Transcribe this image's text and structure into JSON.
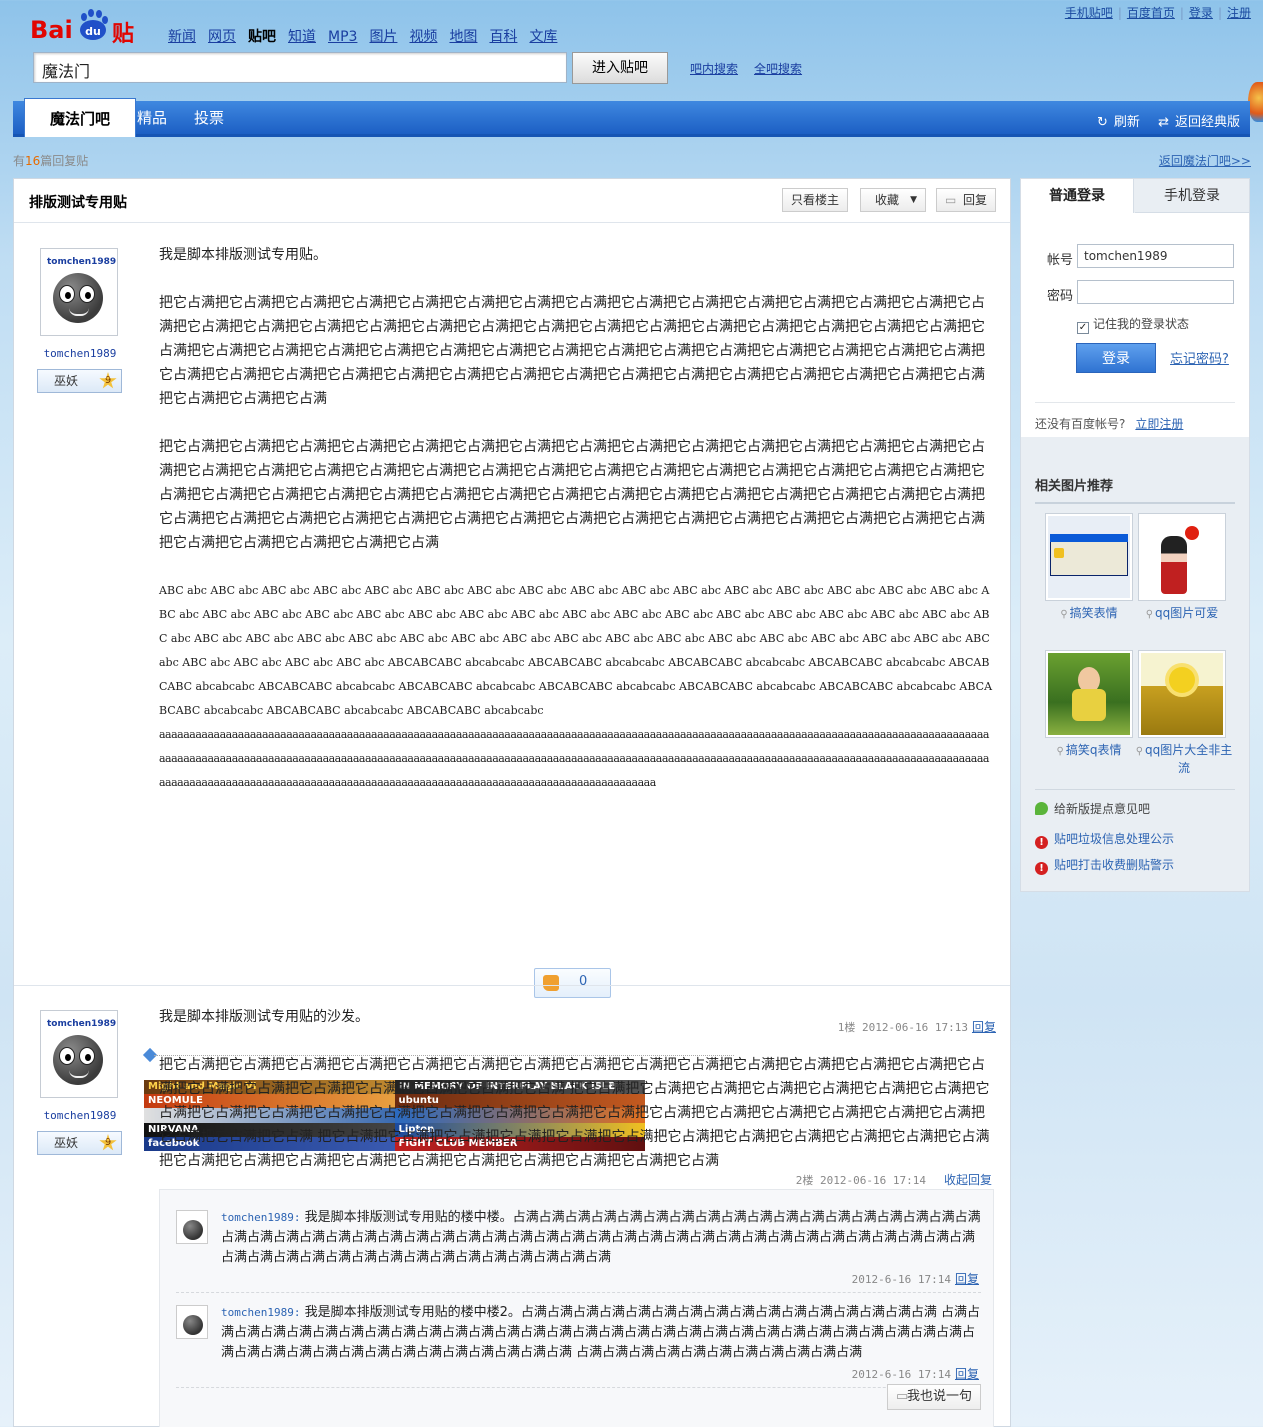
{
  "toplinks": [
    "手机贴吧",
    "百度首页",
    "登录",
    "注册"
  ],
  "logo": {
    "left": "Bai",
    "paw": "du",
    "right": "贴吧"
  },
  "nav": {
    "items": [
      "新闻",
      "网页",
      "贴吧",
      "知道",
      "MP3",
      "图片",
      "视频",
      "地图",
      "百科",
      "文库"
    ],
    "current": "贴吧"
  },
  "search": {
    "value": "魔法门",
    "enter_label": "进入贴吧",
    "in_bar": "吧内搜索",
    "all_bar": "全吧搜索"
  },
  "tabs": {
    "active": "魔法门吧",
    "jingpin": "精品",
    "vote": "投票",
    "refresh": "刷新",
    "classic": "返回经典版"
  },
  "reply_count": {
    "prefix": "有",
    "count": "16",
    "suffix": "篇回复贴"
  },
  "back_link": "返回魔法门吧>>",
  "thread": {
    "title": "排版测试专用贴",
    "btn_only_owner": "只看楼主",
    "btn_fav": "收藏",
    "btn_reply": "回复"
  },
  "post1": {
    "username": "tomchen1989",
    "avatar_name": "tomchen1989",
    "rank": "巫妖",
    "level": "9",
    "line1": "我是脚本排版测试专用贴。",
    "para2": "把它占满把它占满把它占满把它占满把它占满把它占满把它占满把它占满把它占满把它占满把它占满把它占满把它占满把它占满把它占满把它占满把它占满把它占满把它占满把它占满把它占满把它占满把它占满把它占满把它占满把它占满把它占满把它占满把它占满把它占满把它占满把它占满把它占满把它占满把它占满把它占满把它占满把它占满把它占满把它占满把它占满把它占满把它占满把它占满把它占满把它占满把它占满把它占满把它占满把它占满把它占满把它占满把它占满把它占满把它占满把它占满把它占满把它占满把它占满把它占满把它占满把它占满",
    "para3": "把它占满把它占满把它占满把它占满把它占满把它占满把它占满把它占满把它占满把它占满把它占满把它占满把它占满把它占满把它占满把它占满把它占满把它占满把它占满把它占满把它占满把它占满把它占满把它占满把它占满把它占满把它占满把它占满把它占满把它占满把它占满把它占满把它占满把它占满把它占满把它占满把它占满把它占满把它占满把它占满把它占满把它占满把它占满把它占满把它占满把它占满把它占满把它占满把它占满把它占满把它占满把它占满把它占满把它占满把它占满把它占满把它占满把它占满把它占满把它占满把它占满把它占满把它占满把它占满",
    "mono1": "ABC abc ABC abc ABC abc ABC abc ABC abc ABC abc ABC abc ABC abc ABC abc ABC abc ABC abc ABC abc ABC abc ABC abc ABC abc ABC abc ABC abc ABC abc ABC abc ABC abc ABC abc ABC abc ABC abc ABC abc ABC abc ABC abc ABC abc ABC abc ABC abc ABC abc ABC abc ABC abc ABC abc ABC abc ABC abc ABC abc ABC abc ABC abc ABC abc ABC abc ABC abc ABC abc ABC abc ABC abc ABC abc ABC abc ABC abc ABC abc ABC abc ABC abc ABC abc ABC abc ABC abc ABCABCABC abcabcabc ABCABCABC abcabcabc ABCABCABC abcabcabc ABCABCABC abcabcabc ABCABCABC abcabcabc ABCABCABC abcabcabc ABCABCABC abcabcabc ABCABCABC abcabcabc ABCABCABC abcabcabc ABCABCABC abcabcabc ABCABCABC abcabcabc ABCABCABC abcabcabc ABCABCABC abcabcabc",
    "mono2": "aaaaaaaaaaaaaaaaaaaaaaaaaaaaaaaaaaaaaaaaaaaaaaaaaaaaaaaaaaaaaaaaaaaaaaaaaaaaaaaaaaaaaaaaaaaaaaaaaaaaaaaaaaaaaaaaaaaaaaaaaaaaaaaaaaaaaaaaaaaaaaaaaaaaaaaaaaaaaaaaaaaaaaaaaaaaaaaaaaaaaaaaaaaaaaaaaaaaaaaaaaaaaaaaaaaaaaaaaaaaaaaaaaaaaaaaaaaaaaaaaaaaaaaaaaaaaaaaaaaaaaaaaaaaaaaaaaaaaaaaaaaaaaaaaaaaaaaaaaaaaaaaaaaaaaaaaaaaaaaaaaaaaaaaaaaaaaaaaaaaaaaaaaaaaaaaaaaa",
    "like_count": "0",
    "floor": "1楼",
    "time": "2012-06-16 17:13",
    "reply": "回复",
    "sig": [
      "Might and Magic VI",
      "IN MEMORY OF INTERPLAY BLACK ISLE",
      "NEOMULE",
      "ubuntu",
      "",
      "",
      "NIRVANA",
      "Lipton",
      "facebook",
      "FIGHT CLUB MEMBER"
    ]
  },
  "post2": {
    "username": "tomchen1989",
    "avatar_name": "tomchen1989",
    "rank": "巫妖",
    "level": "9",
    "line1": "我是脚本排版测试专用贴的沙发。",
    "para2": "把它占满把它占满把它占满把它占满把它占满把它占满把它占满把它占满把它占满把它占满把它占满把它占满把它占满把它占满把它占满把它占满把它占满把它占满把它占满把它占满把它占满把它占满 把它占满把它占满把它占满把它占满把它占满把它占满把它占满把它占满把它占满把它占满把它占满把它占满把它占满把它占满把它占满把它占满把它占满把它占满把它占满把它占满把它占满把它占满把它占满把它占满把它占满 把它占满把它占满把它占满把它占满把它占满把它占满把它占满把它占满把它占满把它占满把它占满把它占满把它占满把它占满把它占满把它占满把它占满把它占满把它占满把它占满把它占满把它占满",
    "floor": "2楼",
    "time": "2012-06-16 17:14",
    "fold": "收起回复",
    "lzl": [
      {
        "user": "tomchen1989:",
        "text": "我是脚本排版测试专用贴的楼中楼。占满占满占满占满占满占满占满占满占满占满占满占满占满占满占满占满占满占满占满占满占满占满占满占满占满占满占满占满占满占满占满占满占满占满占满占满占满占满占满占满占满占满占满占满占满占满占满占满占满占满占满占满占满占满占满占满占满占满占满占满占满占满",
        "time": "2012-6-16 17:14",
        "reply": "回复"
      },
      {
        "user": "tomchen1989:",
        "text": "我是脚本排版测试专用贴的楼中楼2。占满占满占满占满占满占满占满占满占满占满占满占满占满占满占满占满 占满占满占满占满占满占满占满占满占满占满占满占满占满占满占满占满占满占满占满占满占满占满占满占满占满占满占满占满占满占满占满占满占满占满占满占满占满占满占满占满占满占满占满占满 占满占满占满占满占满占满占满占满占满占满占满",
        "time": "2012-6-16 17:14",
        "reply": "回复"
      }
    ],
    "say": "我也说一句"
  },
  "login": {
    "tab_normal": "普通登录",
    "tab_mobile": "手机登录",
    "account_label": "帐号",
    "account_value": "tomchen1989",
    "password_label": "密码",
    "password_value": "",
    "remember": "记住我的登录状态",
    "login_btn": "登录",
    "forgot": "忘记密码?",
    "no_account": "还没有百度帐号?",
    "register": "立即注册"
  },
  "recommend": {
    "title": "相关图片推荐",
    "items": [
      "搞笑表情",
      "qq图片可爱",
      "搞笑q表情",
      "qq图片大全非主流"
    ]
  },
  "notices": [
    "给新版提点意见吧",
    "贴吧垃圾信息处理公示",
    "贴吧打击收费删贴警示"
  ]
}
